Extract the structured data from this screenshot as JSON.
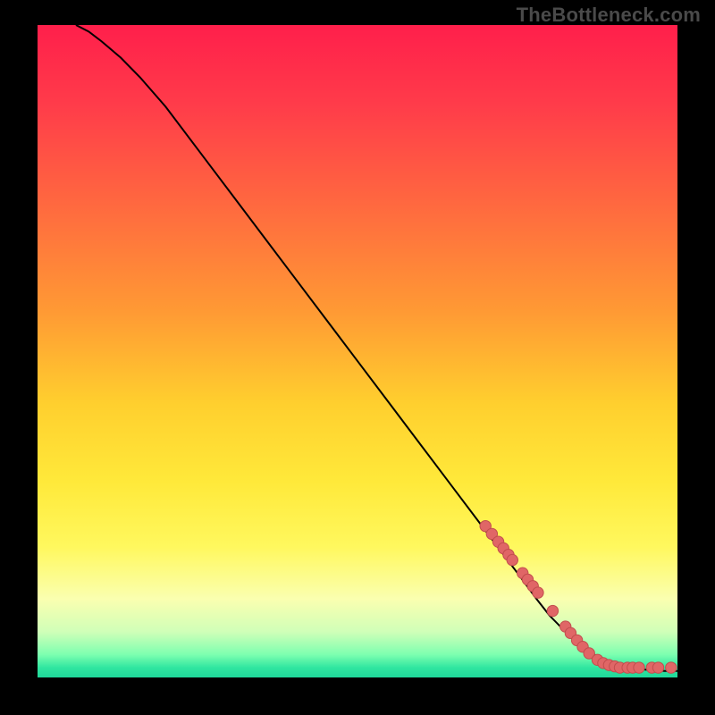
{
  "watermark": "TheBottleneck.com",
  "colors": {
    "page_bg": "#000000",
    "curve": "#000000",
    "marker_fill": "#e06666",
    "marker_stroke": "#c24d4d",
    "gradient_stops": [
      {
        "offset": 0.0,
        "color": "#ff1f4b"
      },
      {
        "offset": 0.12,
        "color": "#ff3b4a"
      },
      {
        "offset": 0.28,
        "color": "#ff6a3f"
      },
      {
        "offset": 0.44,
        "color": "#ff9a34"
      },
      {
        "offset": 0.58,
        "color": "#ffcf2e"
      },
      {
        "offset": 0.7,
        "color": "#ffe93a"
      },
      {
        "offset": 0.8,
        "color": "#fff85e"
      },
      {
        "offset": 0.88,
        "color": "#faffb0"
      },
      {
        "offset": 0.93,
        "color": "#d0ffb8"
      },
      {
        "offset": 0.965,
        "color": "#7dffb0"
      },
      {
        "offset": 0.985,
        "color": "#30e6a0"
      },
      {
        "offset": 1.0,
        "color": "#1fd89a"
      }
    ]
  },
  "chart_data": {
    "type": "line",
    "title": "",
    "xlabel": "",
    "ylabel": "",
    "xlim": [
      0,
      100
    ],
    "ylim": [
      0,
      100
    ],
    "grid": false,
    "legend": null,
    "series": [
      {
        "name": "curve",
        "kind": "line",
        "x": [
          6,
          8,
          10,
          13,
          16,
          20,
          25,
          30,
          35,
          40,
          45,
          50,
          55,
          60,
          65,
          70,
          75,
          78,
          80,
          83,
          86,
          89,
          92,
          95,
          98,
          100
        ],
        "y": [
          100,
          99,
          97.5,
          95,
          92,
          87.5,
          81,
          74.5,
          68,
          61.5,
          55,
          48.5,
          42,
          35.5,
          29,
          22.5,
          16,
          12,
          9.5,
          6.5,
          4,
          2.5,
          1.6,
          1.2,
          1.0,
          1.0
        ]
      },
      {
        "name": "markers",
        "kind": "scatter",
        "x": [
          70,
          71,
          72,
          72.8,
          73.6,
          74.2,
          75.8,
          76.6,
          77.4,
          78.2,
          80.5,
          82.5,
          83.3,
          84.3,
          85.2,
          86.2,
          87.5,
          88.4,
          89.3,
          90.2,
          91.0,
          92.2,
          93.0,
          94.0,
          96.0,
          97.0,
          99.0
        ],
        "y": [
          23.2,
          22.0,
          20.8,
          19.8,
          18.8,
          18.0,
          16.0,
          15.0,
          14.0,
          13.0,
          10.2,
          7.8,
          6.8,
          5.7,
          4.7,
          3.7,
          2.7,
          2.2,
          1.9,
          1.7,
          1.5,
          1.5,
          1.5,
          1.5,
          1.5,
          1.5,
          1.5
        ]
      }
    ]
  }
}
